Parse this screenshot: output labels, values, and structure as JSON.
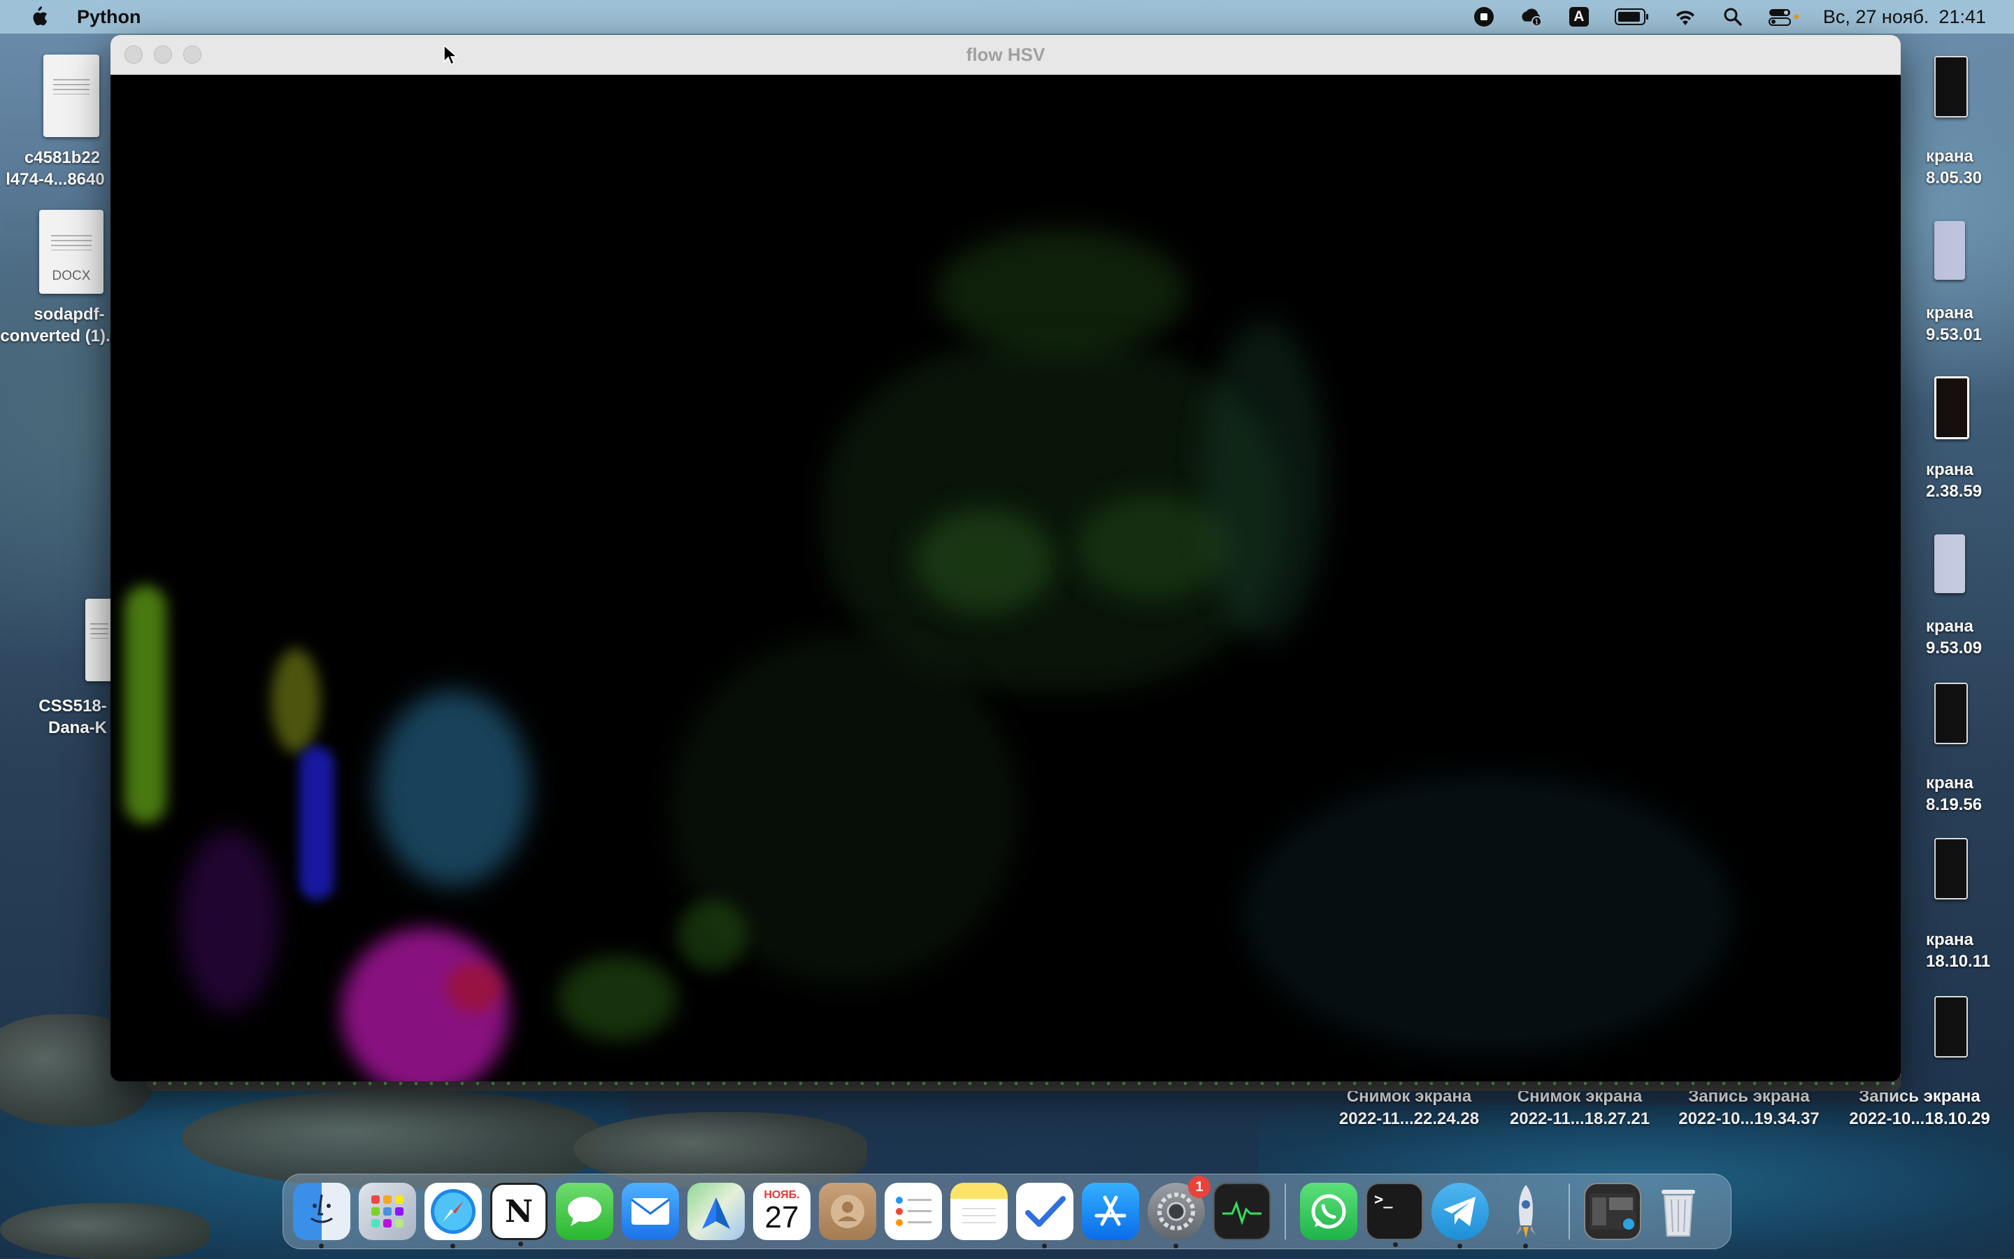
{
  "menubar": {
    "app_name": "Python",
    "date": "Вс, 27 нояб.",
    "time": "21:41",
    "input_source": "A"
  },
  "window": {
    "title": "flow HSV"
  },
  "desktop_left": [
    {
      "line1": "c4581b22",
      "line2": "l474-4...8640"
    },
    {
      "line1": "sodapdf-",
      "line2": "converted (1)."
    },
    {
      "line1": "CSS518-",
      "line2": "Dana-K"
    }
  ],
  "docx_label": "DOCX",
  "desktop_right": [
    {
      "line1": "крана",
      "line2": "8.05.30"
    },
    {
      "line1": "крана",
      "line2": "9.53.01"
    },
    {
      "line1": "крана",
      "line2": "2.38.59"
    },
    {
      "line1": "крана",
      "line2": "9.53.09"
    },
    {
      "line1": "крана",
      "line2": "8.19.56"
    },
    {
      "line1": "крана",
      "line2": "18.10.11"
    }
  ],
  "desktop_bottom": [
    {
      "line1": "Снимок экрана",
      "line2": "2022-11...22.24.28"
    },
    {
      "line1": "Снимок экрана",
      "line2": "2022-11...18.27.21"
    },
    {
      "line1": "Запись экрана",
      "line2": "2022-10...19.34.37"
    },
    {
      "line1": "Запись экрана",
      "line2": "2022-10...18.10.29"
    }
  ],
  "dock": {
    "calendar_month": "НОЯБ.",
    "calendar_day": "27",
    "settings_badge": "1",
    "notion_letter": "N",
    "terminal_prompt": ">_"
  }
}
